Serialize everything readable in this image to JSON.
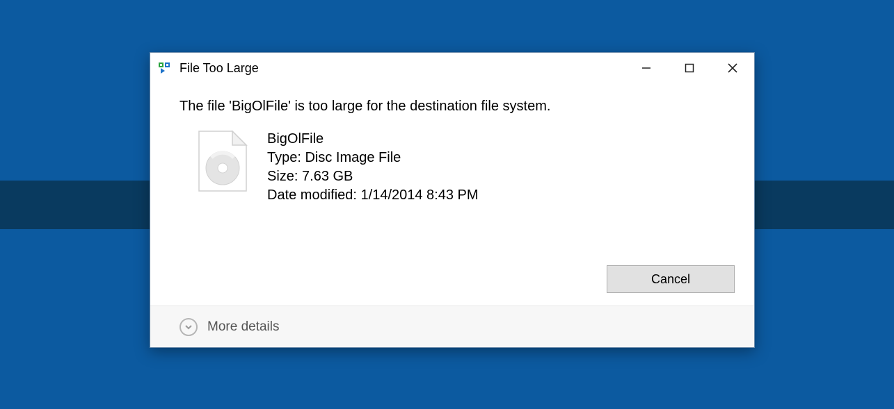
{
  "titlebar": {
    "title": "File Too Large"
  },
  "message": "The file 'BigOlFile' is too large for the destination file system.",
  "file": {
    "name": "BigOlFile",
    "type_label": "Type: Disc Image File",
    "size_label": "Size: 7.63 GB",
    "modified_label": "Date modified: 1/14/2014 8:43 PM"
  },
  "buttons": {
    "cancel": "Cancel"
  },
  "footer": {
    "more_details": "More details"
  }
}
